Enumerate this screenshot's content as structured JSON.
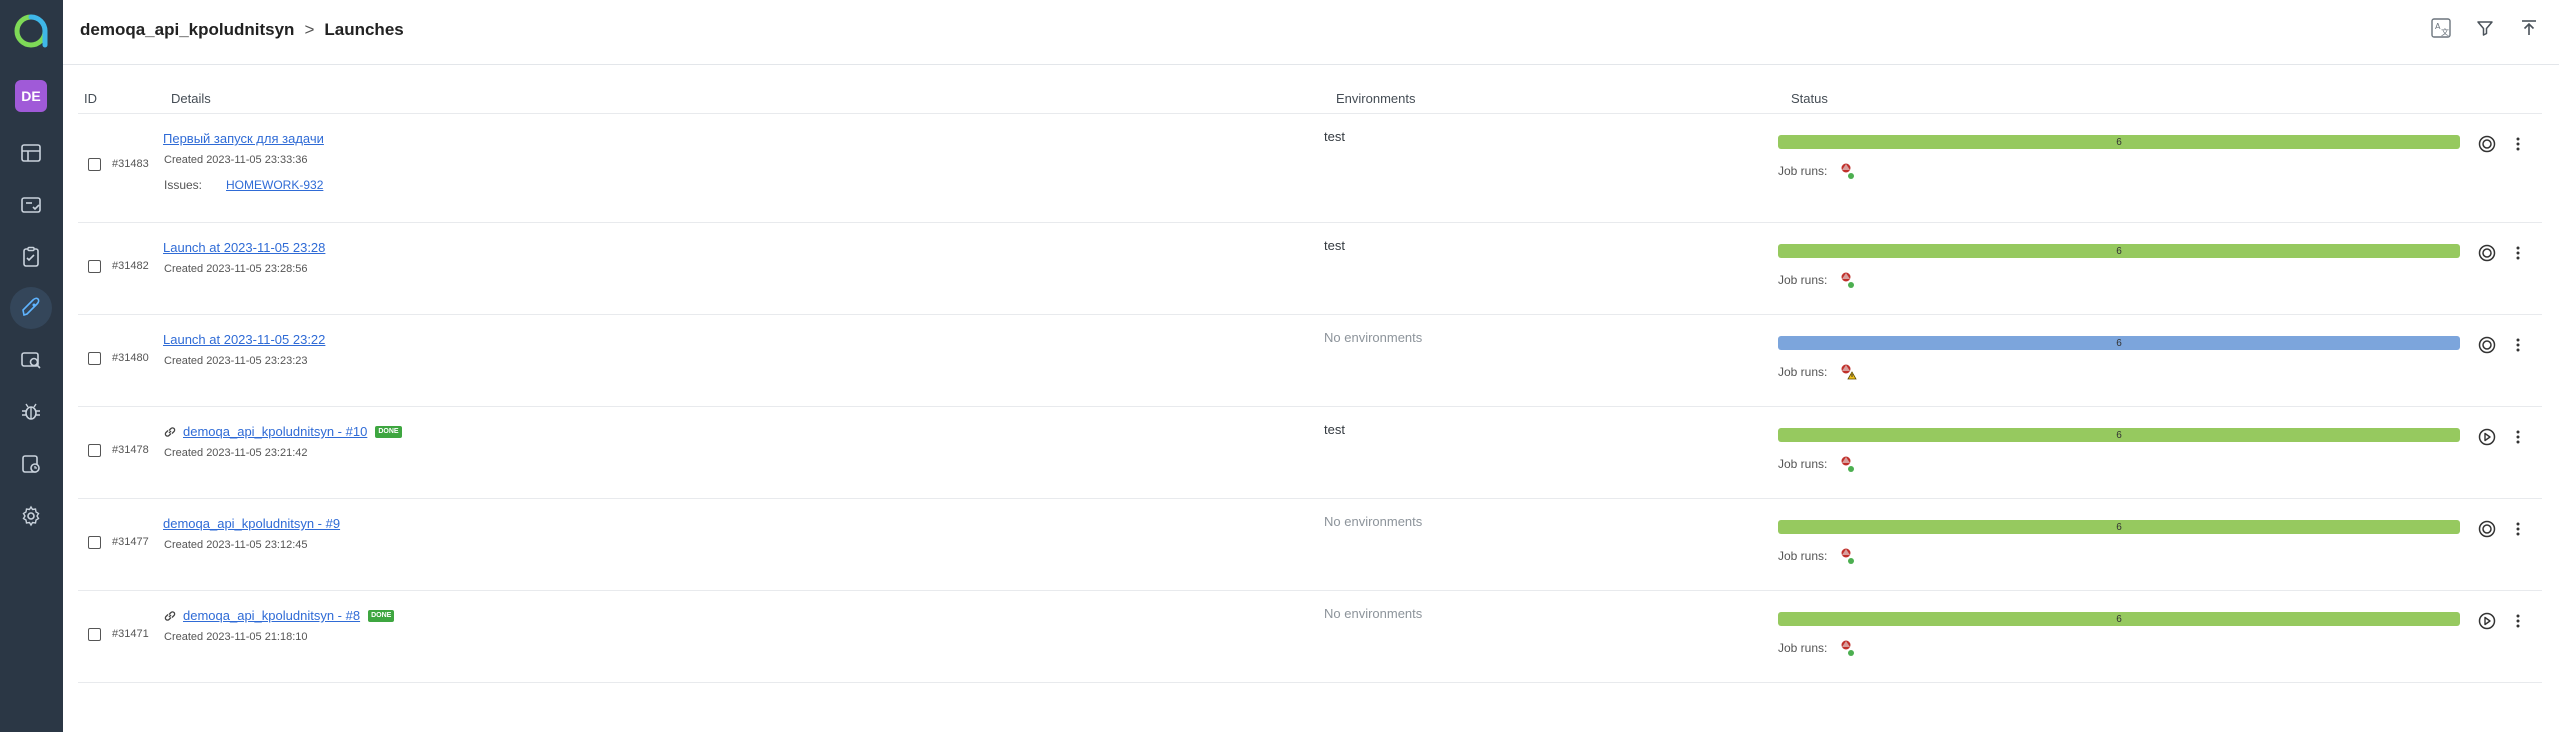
{
  "breadcrumb": {
    "project": "demoqa_api_kpoludnitsyn",
    "separator": ">",
    "page": "Launches"
  },
  "user": {
    "initials": "DE"
  },
  "table": {
    "headers": {
      "id": "ID",
      "details": "Details",
      "environments": "Environments",
      "status": "Status"
    }
  },
  "job_runs_label": "Job runs:",
  "colors": {
    "passed": "#96c95f",
    "in_progress": "#7ca5dc",
    "sidebar": "#2b3745",
    "link": "#2f6bd6",
    "badge": "#3ea640"
  },
  "launches": [
    {
      "id": "#31483",
      "name": "Первый запуск для задачи",
      "created": "Created 2023-11-05 23:33:36",
      "issues_label": "Issues:",
      "issue": "HOMEWORK-932",
      "env": "test",
      "bar_value": "6",
      "status": "passed",
      "action_icon": "stop-icon",
      "runner_state": "ok"
    },
    {
      "id": "#31482",
      "name": "Launch at 2023-11-05 23:28",
      "created": "Created 2023-11-05 23:28:56",
      "env": "test",
      "bar_value": "6",
      "status": "passed",
      "action_icon": "stop-icon",
      "runner_state": "ok"
    },
    {
      "id": "#31480",
      "name": "Launch at 2023-11-05 23:22",
      "created": "Created 2023-11-05 23:23:23",
      "env": "No environments",
      "bar_value": "6",
      "status": "in_progress",
      "action_icon": "stop-icon",
      "runner_state": "warning"
    },
    {
      "id": "#31478",
      "name": "demoqa_api_kpoludnitsyn - #10",
      "badge": "DONE",
      "created": "Created 2023-11-05 23:21:42",
      "env": "test",
      "bar_value": "6",
      "status": "passed",
      "action_icon": "play-icon",
      "runner_state": "ok"
    },
    {
      "id": "#31477",
      "name": "demoqa_api_kpoludnitsyn - #9",
      "created": "Created 2023-11-05 23:12:45",
      "env": "No environments",
      "bar_value": "6",
      "status": "passed",
      "action_icon": "stop-icon",
      "runner_state": "ok"
    },
    {
      "id": "#31471",
      "name": "demoqa_api_kpoludnitsyn - #8",
      "badge": "DONE",
      "created": "Created 2023-11-05 21:18:10",
      "env": "No environments",
      "bar_value": "6",
      "status": "passed",
      "action_icon": "play-icon",
      "runner_state": "ok"
    }
  ]
}
